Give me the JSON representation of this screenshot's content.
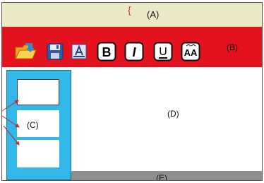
{
  "title_bar": {
    "label": "(A)"
  },
  "toolbar": {
    "label": "(B)",
    "buttons": [
      {
        "name": "open-icon"
      },
      {
        "name": "save-icon"
      },
      {
        "name": "text-style-icon"
      },
      {
        "name": "bold-icon",
        "glyph": "B"
      },
      {
        "name": "italic-icon",
        "glyph": "I"
      },
      {
        "name": "underline-icon",
        "glyph": "U"
      },
      {
        "name": "font-size-icon",
        "glyph": "AA"
      }
    ]
  },
  "sidebar": {
    "label": "(C)"
  },
  "canvas": {
    "label": "(D)"
  },
  "status_bar": {
    "label": "(E)"
  },
  "colors": {
    "title_bar": "#ece9c6",
    "toolbar": "#e4121f",
    "sidebar": "#33b7e8",
    "status_bar": "#8f8f8f"
  }
}
